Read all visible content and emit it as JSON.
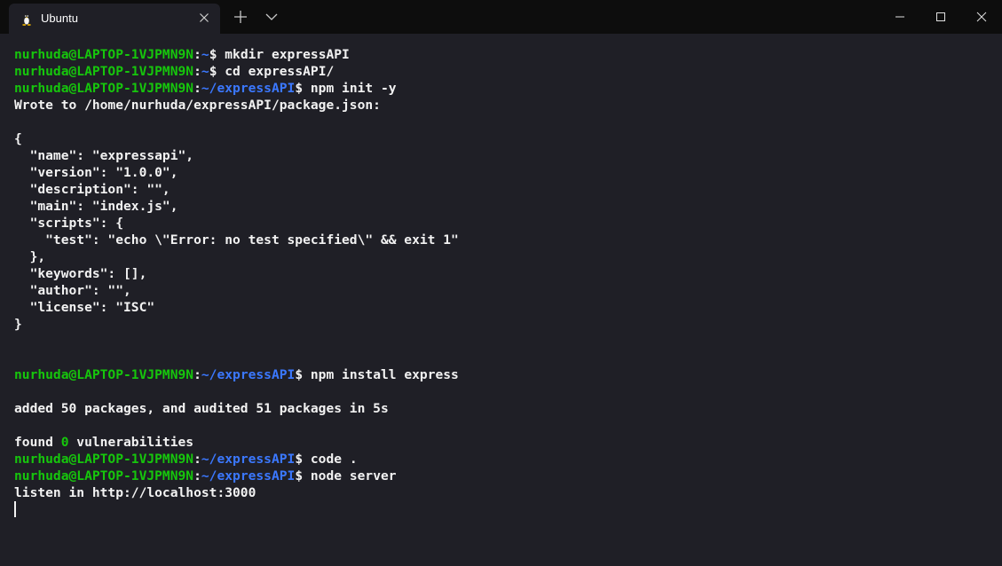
{
  "tab": {
    "title": "Ubuntu",
    "icon": "linux-tux-icon"
  },
  "window_controls": [
    "minimize-icon",
    "maximize-icon",
    "close-icon"
  ],
  "colors": {
    "prompt_user": "#16c60c",
    "prompt_path": "#3b78ff",
    "text": "#f2f2f2",
    "background": "#1f1f26"
  },
  "terminal": {
    "lines": [
      {
        "user": "nurhuda@LAPTOP-1VJPMN9N",
        "sep": ":",
        "path": "~",
        "cmd": "$ mkdir expressAPI"
      },
      {
        "user": "nurhuda@LAPTOP-1VJPMN9N",
        "sep": ":",
        "path": "~",
        "cmd": "$ cd expressAPI/"
      },
      {
        "user": "nurhuda@LAPTOP-1VJPMN9N",
        "sep": ":",
        "path": "~/expressAPI",
        "cmd": "$ npm init -y"
      },
      {
        "text": "Wrote to /home/nurhuda/expressAPI/package.json:"
      },
      {
        "text": ""
      },
      {
        "text": "{"
      },
      {
        "text": "  \"name\": \"expressapi\","
      },
      {
        "text": "  \"version\": \"1.0.0\","
      },
      {
        "text": "  \"description\": \"\","
      },
      {
        "text": "  \"main\": \"index.js\","
      },
      {
        "text": "  \"scripts\": {"
      },
      {
        "text": "    \"test\": \"echo \\\"Error: no test specified\\\" && exit 1\""
      },
      {
        "text": "  },"
      },
      {
        "text": "  \"keywords\": [],"
      },
      {
        "text": "  \"author\": \"\","
      },
      {
        "text": "  \"license\": \"ISC\""
      },
      {
        "text": "}"
      },
      {
        "text": ""
      },
      {
        "text": ""
      },
      {
        "user": "nurhuda@LAPTOP-1VJPMN9N",
        "sep": ":",
        "path": "~/expressAPI",
        "cmd": "$ npm install express"
      },
      {
        "text": ""
      },
      {
        "text": "added 50 packages, and audited 51 packages in 5s"
      },
      {
        "text": ""
      },
      {
        "pre": "found ",
        "num": "0",
        "post": " vulnerabilities"
      },
      {
        "user": "nurhuda@LAPTOP-1VJPMN9N",
        "sep": ":",
        "path": "~/expressAPI",
        "cmd": "$ code ."
      },
      {
        "user": "nurhuda@LAPTOP-1VJPMN9N",
        "sep": ":",
        "path": "~/expressAPI",
        "cmd": "$ node server"
      },
      {
        "text": "listen in http://localhost:3000"
      },
      {
        "cursor": true
      }
    ]
  }
}
